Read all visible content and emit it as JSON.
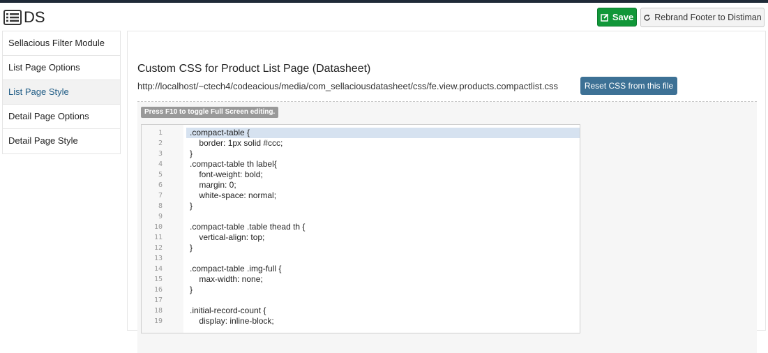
{
  "app": {
    "title": "DS"
  },
  "toolbar": {
    "save_label": "Save",
    "rebrand_label": "Rebrand Footer to Distiman"
  },
  "sidebar": {
    "items": [
      {
        "label": "Sellacious Filter Module",
        "active": false
      },
      {
        "label": "List Page Options",
        "active": false
      },
      {
        "label": "List Page Style",
        "active": true
      },
      {
        "label": "Detail Page Options",
        "active": false
      },
      {
        "label": "Detail Page Style",
        "active": false
      }
    ]
  },
  "main": {
    "section_title": "Custom CSS for Product List Page (Datasheet)",
    "file_path": "http://localhost/~ctech4/codeacious/media/com_sellaciousdatasheet/css/fe.view.products.compactlist.css",
    "reset_label": "Reset CSS from this file",
    "fullscreen_hint": "Press F10 to toggle Full Screen editing.",
    "editor": {
      "lines": [
        {
          "num": "1",
          "text": ".compact-table {"
        },
        {
          "num": "2",
          "text": "    border: 1px solid #ccc;"
        },
        {
          "num": "3",
          "text": "}"
        },
        {
          "num": "4",
          "text": ".compact-table th label{"
        },
        {
          "num": "5",
          "text": "    font-weight: bold;"
        },
        {
          "num": "6",
          "text": "    margin: 0;"
        },
        {
          "num": "7",
          "text": "    white-space: normal;"
        },
        {
          "num": "8",
          "text": "}"
        },
        {
          "num": "9",
          "text": ""
        },
        {
          "num": "10",
          "text": ".compact-table .table thead th {"
        },
        {
          "num": "11",
          "text": "    vertical-align: top;"
        },
        {
          "num": "12",
          "text": "}"
        },
        {
          "num": "13",
          "text": ""
        },
        {
          "num": "14",
          "text": ".compact-table .img-full {"
        },
        {
          "num": "15",
          "text": "    max-width: none;"
        },
        {
          "num": "16",
          "text": "}"
        },
        {
          "num": "17",
          "text": ""
        },
        {
          "num": "18",
          "text": ".initial-record-count {"
        },
        {
          "num": "19",
          "text": "    display: inline-block;"
        }
      ],
      "current_line": "1"
    }
  },
  "colors": {
    "save_button": "#119739",
    "reset_button": "#3d7195",
    "active_sidebar_text": "#215d86",
    "current_line_highlight": "#d6e2f0"
  },
  "icons": {
    "logo": "list-icon",
    "save": "edit-icon",
    "rebrand": "refresh-icon"
  }
}
